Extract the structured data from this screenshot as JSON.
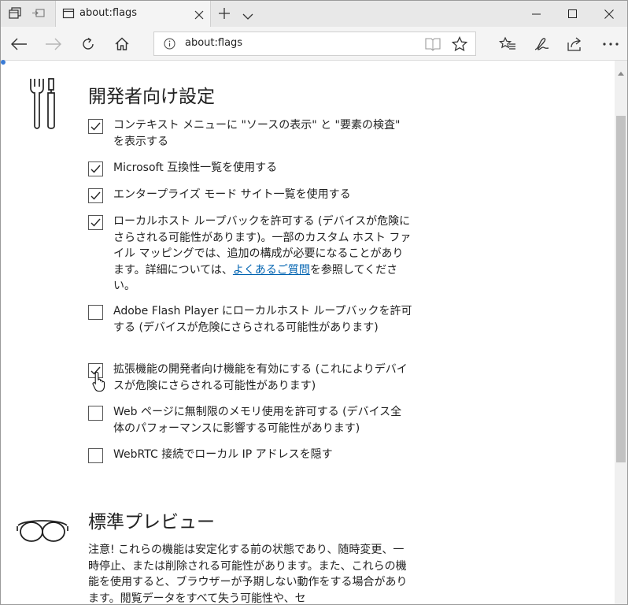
{
  "tab": {
    "title": "about:flags"
  },
  "address": {
    "url": "about:flags"
  },
  "sections": {
    "developer": {
      "title": "開発者向け設定",
      "flags": [
        {
          "text": "コンテキスト メニューに \"ソースの表示\" と \"要素の検査\" を表示する",
          "checked": true
        },
        {
          "text": "Microsoft 互換性一覧を使用する",
          "checked": true
        },
        {
          "text": "エンタープライズ モード サイト一覧を使用する",
          "checked": true
        },
        {
          "text": "ローカルホスト ループバックを許可する (デバイスが危険にさらされる可能性があります)。一部のカスタム ホスト ファイル マッピングでは、追加の構成が必要になることがあります。詳細については、",
          "link": "よくあるご質問",
          "after": "を参照してください。",
          "checked": true
        },
        {
          "text": "Adobe Flash Player にローカルホスト ループバックを許可する (デバイスが危険にさらされる可能性があります)",
          "checked": false
        },
        {
          "text": "拡張機能の開発者向け機能を有効にする (これによりデバイスが危険にさらされる可能性があります)",
          "checked": true
        },
        {
          "text": "Web ページに無制限のメモリ使用を許可する (デバイス全体のパフォーマンスに影響する可能性があります)",
          "checked": false
        },
        {
          "text": "WebRTC 接続でローカル IP アドレスを隠す",
          "checked": false
        }
      ]
    },
    "preview": {
      "title": "標準プレビュー",
      "description": "注意! これらの機能は安定化する前の状態であり、随時変更、一時停止、または削除される可能性があります。また、これらの機能を使用すると、ブラウザーが予期しない動作をする場合があります。閲覧データをすべて失う可能性や、セ"
    }
  },
  "icons": {
    "tab_manager": "tab-set-aside-icon",
    "back": "back-arrow-icon",
    "forward": "forward-arrow-icon",
    "refresh": "refresh-icon",
    "home": "home-icon",
    "hub": "hub-icon",
    "notes": "web-note-icon",
    "share": "share-icon",
    "more": "more-icon"
  },
  "colors": {
    "link": "#0063b1",
    "chrome": "#e8e8e8",
    "navbar": "#f4f4f4"
  }
}
